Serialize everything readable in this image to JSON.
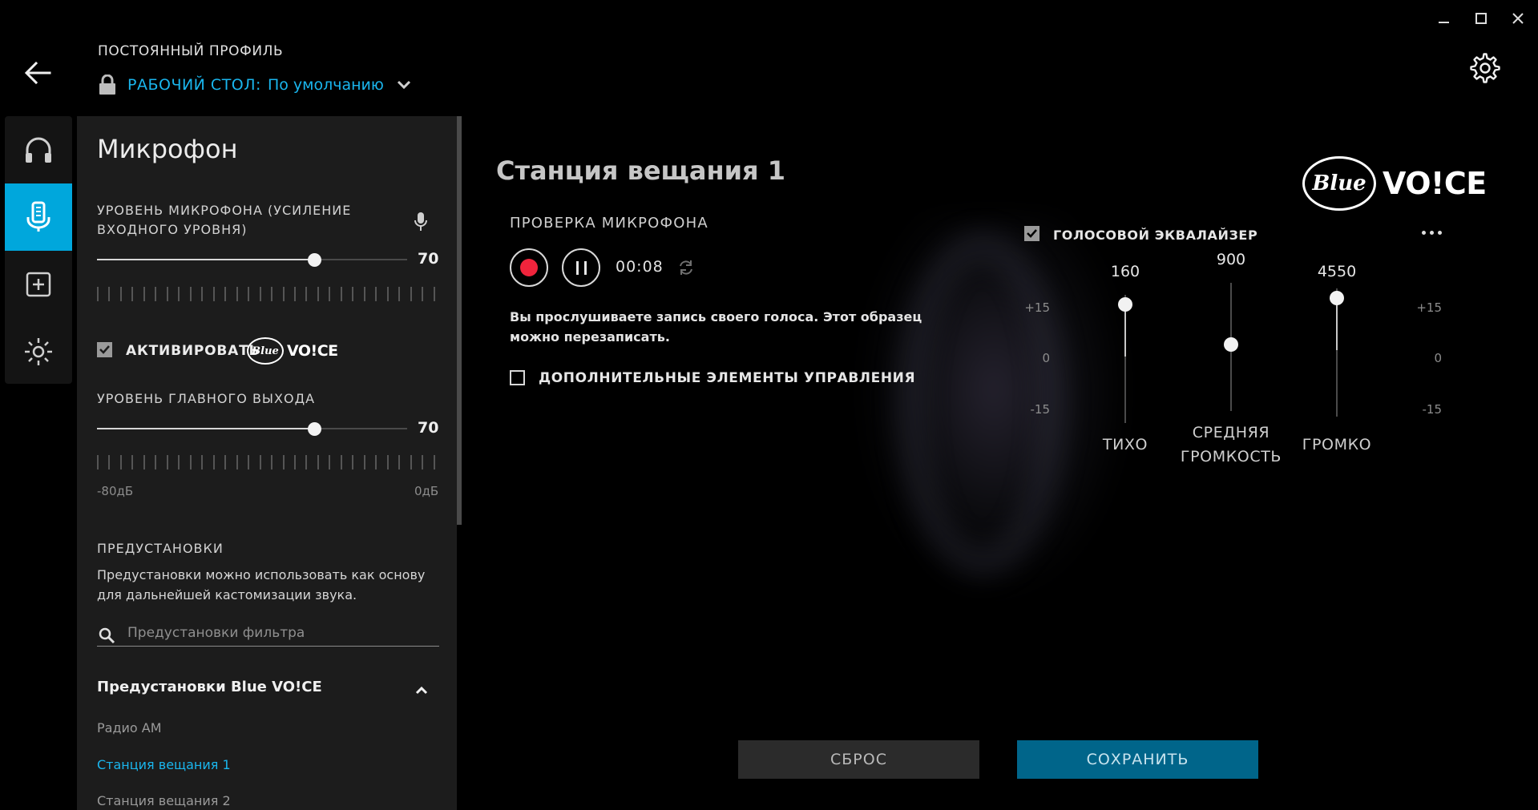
{
  "header": {
    "profile_label": "ПОСТОЯННЫЙ ПРОФИЛЬ",
    "profile_key": "РАБОЧИЙ СТОЛ:",
    "profile_value": "По умолчанию"
  },
  "nav": {
    "items": [
      {
        "icon": "headphones-icon",
        "active": false
      },
      {
        "icon": "microphone-icon",
        "active": true
      },
      {
        "icon": "add-assignment-icon",
        "active": false
      },
      {
        "icon": "lighting-icon",
        "active": false
      }
    ]
  },
  "panel": {
    "title": "Микрофон",
    "mic_level": {
      "label": "УРОВЕНЬ МИКРОФОНА (УСИЛЕНИЕ ВХОДНОГО УРОВНЯ)",
      "value": "70",
      "percent": 70
    },
    "activate": {
      "label": "АКТИВИРОВАТЬ",
      "checked": true,
      "logo_oval": "Blue",
      "logo_word": "VO!CE"
    },
    "main_output": {
      "label": "УРОВЕНЬ ГЛАВНОГО ВЫХОДА",
      "value": "70",
      "percent": 70,
      "min_label": "-80дБ",
      "max_label": "0дБ"
    },
    "presets": {
      "title": "ПРЕДУСТАНОВКИ",
      "description": "Предустановки можно использовать как основу для дальнейшей кастомизации звука.",
      "filter_placeholder": "Предустановки фильтра",
      "group_title": "Предустановки Blue VO!CE",
      "items": [
        "Радио АМ",
        "Станция вещания 1",
        "Станция вещания 2"
      ],
      "selected": "Станция вещания 1"
    }
  },
  "main": {
    "title": "Станция вещания 1",
    "mic_test": {
      "label": "ПРОВЕРКА МИКРОФОНА",
      "time": "00:08"
    },
    "info": "Вы прослушиваете запись своего голоса. Этот образец можно перезаписать.",
    "advanced": {
      "label": "ДОПОЛНИТЕЛЬНЫЕ ЭЛЕМЕНТЫ УПРАВЛЕНИЯ",
      "checked": false
    },
    "logo": {
      "oval": "Blue",
      "word": "VO!CE"
    },
    "equalizer": {
      "label": "ГОЛОСОВОЙ ЭКВАЛАЙЗЕР",
      "checked": true,
      "scale": [
        "+15",
        "0",
        "-15"
      ],
      "bands": [
        {
          "freq": "160",
          "name": "ТИХО",
          "gain": 15
        },
        {
          "freq": "900",
          "name": "СРЕДНЯЯ ГРОМКОСТЬ",
          "gain": 0
        },
        {
          "freq": "4550",
          "name": "ГРОМКО",
          "gain": 15
        }
      ]
    },
    "reset_label": "СБРОС",
    "save_label": "СОХРАНИТЬ"
  },
  "colors": {
    "accent": "#00a7dc",
    "accent_text": "#1ab6ee",
    "record": "#f0243c",
    "save_bg": "#00658a"
  }
}
